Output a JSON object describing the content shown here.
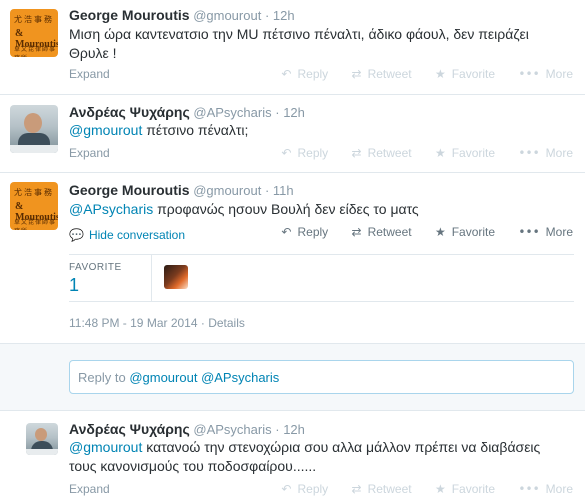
{
  "tweets": [
    {
      "fullname": "George Mouroutis",
      "username": "@gmourout",
      "time": "12h",
      "text_line1": "Μιση ώρα καντενατσιο την MU πέτσινο πέναλτι, άδικο φάουλ, δεν πειράζει",
      "text_line2": "Θρυλε !",
      "expand": "Expand",
      "avatar_text": {
        "top": "尤浩事務",
        "mid": "& Mouroutis",
        "bot": "卓文昆律師事務所"
      }
    },
    {
      "fullname": "Ανδρέας Ψυχάρης",
      "username": "@APsycharis",
      "time": "12h",
      "mention": "@gmourout",
      "text": " πέτσινο πέναλτι;",
      "expand": "Expand"
    },
    {
      "fullname": "George Mouroutis",
      "username": "@gmourout",
      "time": "11h",
      "mention": "@APsycharis",
      "text": " προφανώς ησουν Βουλή δεν είδες το ματς",
      "hide_conversation": "Hide conversation",
      "favorite_label": "FAVORITE",
      "favorite_count": "1",
      "timestamp": "11:48 PM - 19 Mar 2014",
      "details": "Details",
      "avatar_text": {
        "top": "尤浩事務",
        "mid": "& Mouroutis",
        "bot": "卓文昆律師事務所"
      }
    },
    {
      "fullname": "Ανδρέας Ψυχάρης",
      "username": "@APsycharis",
      "time": "12h",
      "mention": "@gmourout",
      "text_line1": " κατανοώ την στενοχώρια σου αλλα μάλλον πρέπει να διαβάσεις",
      "text_line2": "τους κανονισμούς του ποδοσφαίρου......",
      "expand": "Expand"
    }
  ],
  "actions": {
    "reply": "Reply",
    "retweet": "Retweet",
    "favorite": "Favorite",
    "more": "More"
  },
  "reply_box": {
    "prefix": "Reply to ",
    "mention1": "@gmourout",
    "mention2": "@APsycharis"
  },
  "icons": {
    "reply": "reply-arrow-icon",
    "retweet": "retweet-icon",
    "favorite": "star-icon",
    "more": "more-dots-icon",
    "hide": "speech-bubble-icon"
  },
  "colors": {
    "link": "#0084b4",
    "muted": "#8899a6",
    "border": "#e1e8ed",
    "orange_avatar": "#f0941f"
  }
}
